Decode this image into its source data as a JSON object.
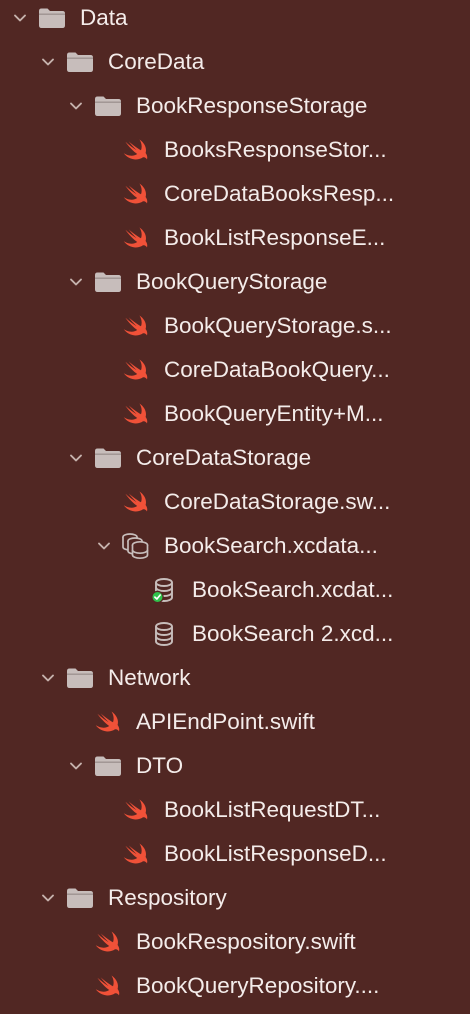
{
  "tree": [
    {
      "label": "Data",
      "kind": "folder",
      "depth": 0,
      "expanded": true
    },
    {
      "label": "CoreData",
      "kind": "folder",
      "depth": 1,
      "expanded": true
    },
    {
      "label": "BookResponseStorage",
      "kind": "folder",
      "depth": 2,
      "expanded": true
    },
    {
      "label": "BooksResponseStor...",
      "kind": "swift",
      "depth": 3
    },
    {
      "label": "CoreDataBooksResp...",
      "kind": "swift",
      "depth": 3
    },
    {
      "label": "BookListResponseE...",
      "kind": "swift",
      "depth": 3
    },
    {
      "label": "BookQueryStorage",
      "kind": "folder",
      "depth": 2,
      "expanded": true
    },
    {
      "label": "BookQueryStorage.s...",
      "kind": "swift",
      "depth": 3
    },
    {
      "label": "CoreDataBookQuery...",
      "kind": "swift",
      "depth": 3
    },
    {
      "label": "BookQueryEntity+M...",
      "kind": "swift",
      "depth": 3
    },
    {
      "label": "CoreDataStorage",
      "kind": "folder",
      "depth": 2,
      "expanded": true
    },
    {
      "label": "CoreDataStorage.sw...",
      "kind": "swift",
      "depth": 3
    },
    {
      "label": "BookSearch.xcdata...",
      "kind": "datamodel",
      "depth": 3,
      "expanded": true
    },
    {
      "label": "BookSearch.xcdat...",
      "kind": "model-version-current",
      "depth": 4
    },
    {
      "label": "BookSearch 2.xcd...",
      "kind": "model-version",
      "depth": 4
    },
    {
      "label": "Network",
      "kind": "folder",
      "depth": 1,
      "expanded": true
    },
    {
      "label": "APIEndPoint.swift",
      "kind": "swift",
      "depth": 2
    },
    {
      "label": "DTO",
      "kind": "folder",
      "depth": 2,
      "expanded": true
    },
    {
      "label": "BookListRequestDT...",
      "kind": "swift",
      "depth": 3
    },
    {
      "label": "BookListResponseD...",
      "kind": "swift",
      "depth": 3
    },
    {
      "label": "Respository",
      "kind": "folder",
      "depth": 1,
      "expanded": true
    },
    {
      "label": "BookRespository.swift",
      "kind": "swift",
      "depth": 2
    },
    {
      "label": "BookQueryRepository....",
      "kind": "swift",
      "depth": 2
    }
  ],
  "icons": {
    "folder": "folder-icon",
    "swift": "swift-file-icon",
    "datamodel": "core-data-model-icon",
    "model-version": "database-icon",
    "model-version-current": "database-current-version-icon",
    "chevron": "chevron-down-icon"
  },
  "colors": {
    "background": "#512723",
    "text": "#f4ecea",
    "chevron": "#c6b2ad",
    "folder": "#c7bdbb",
    "swift": "#f05138",
    "database": "#c7bdbb",
    "check": "#30c24b"
  }
}
